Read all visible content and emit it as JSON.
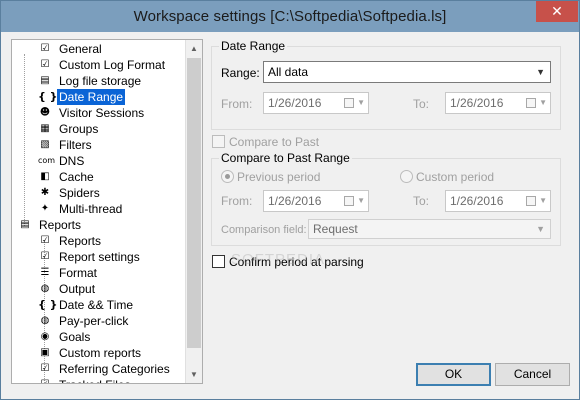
{
  "window": {
    "title": "Workspace settings [C:\\Softpedia\\Softpedia.ls]",
    "close_glyph": "✕"
  },
  "tree": {
    "items": [
      {
        "label": "General",
        "icon": "checklist-icon",
        "glyph": "☑",
        "level": 1
      },
      {
        "label": "Custom Log Format",
        "icon": "checklist-icon",
        "glyph": "☑",
        "level": 1
      },
      {
        "label": "Log file storage",
        "icon": "database-icon",
        "glyph": "▤",
        "level": 1
      },
      {
        "label": "Date Range",
        "icon": "braces-icon",
        "glyph": "{ }",
        "level": 1,
        "selected": true
      },
      {
        "label": "Visitor Sessions",
        "icon": "visitor-icon",
        "glyph": "☻",
        "level": 1
      },
      {
        "label": "Groups",
        "icon": "grid-icon",
        "glyph": "▦",
        "level": 1
      },
      {
        "label": "Filters",
        "icon": "filter-icon",
        "glyph": "▧",
        "level": 1
      },
      {
        "label": "DNS",
        "icon": "dns-icon",
        "glyph": "com",
        "level": 1
      },
      {
        "label": "Cache",
        "icon": "cache-icon",
        "glyph": "◧",
        "level": 1
      },
      {
        "label": "Spiders",
        "icon": "spider-icon",
        "glyph": "✱",
        "level": 1
      },
      {
        "label": "Multi-thread",
        "icon": "thread-icon",
        "glyph": "✦",
        "level": 1
      },
      {
        "label": "Reports",
        "icon": "reports-icon",
        "glyph": "▤",
        "level": 0
      },
      {
        "label": "Reports",
        "icon": "checklist-icon",
        "glyph": "☑",
        "level": 1
      },
      {
        "label": "Report settings",
        "icon": "checklist-icon",
        "glyph": "☑",
        "level": 1
      },
      {
        "label": "Format",
        "icon": "list-icon",
        "glyph": "☰",
        "level": 1
      },
      {
        "label": "Output",
        "icon": "globe-icon",
        "glyph": "◍",
        "level": 1
      },
      {
        "label": "Date && Time",
        "icon": "braces-icon",
        "glyph": "{ }",
        "level": 1
      },
      {
        "label": "Pay-per-click",
        "icon": "globe-icon",
        "glyph": "◍",
        "level": 1
      },
      {
        "label": "Goals",
        "icon": "goals-icon",
        "glyph": "◉",
        "level": 1
      },
      {
        "label": "Custom reports",
        "icon": "custom-report-icon",
        "glyph": "▣",
        "level": 1
      },
      {
        "label": "Referring Categories",
        "icon": "checklist-icon",
        "glyph": "☑",
        "level": 1
      },
      {
        "label": "Tracked Files",
        "icon": "checklist-icon",
        "glyph": "☑",
        "level": 1
      }
    ]
  },
  "date_range": {
    "group_title": "Date Range",
    "range_label": "Range:",
    "range_value": "All data",
    "from_label": "From:",
    "from_value": "1/26/2016",
    "to_label": "To:",
    "to_value": "1/26/2016"
  },
  "compare": {
    "checkbox_label": "Compare to Past",
    "checked": false
  },
  "compare_range": {
    "group_title": "Compare to Past Range",
    "previous_label": "Previous period",
    "custom_label": "Custom period",
    "selected": "previous",
    "from_label": "From:",
    "from_value": "1/26/2016",
    "to_label": "To:",
    "to_value": "1/26/2016",
    "comparison_label": "Comparison field:",
    "comparison_value": "Request"
  },
  "confirm": {
    "checkbox_label": "Confirm period at parsing",
    "checked": false
  },
  "buttons": {
    "ok": "OK",
    "cancel": "Cancel"
  },
  "watermark": "SOFTPEDIA"
}
